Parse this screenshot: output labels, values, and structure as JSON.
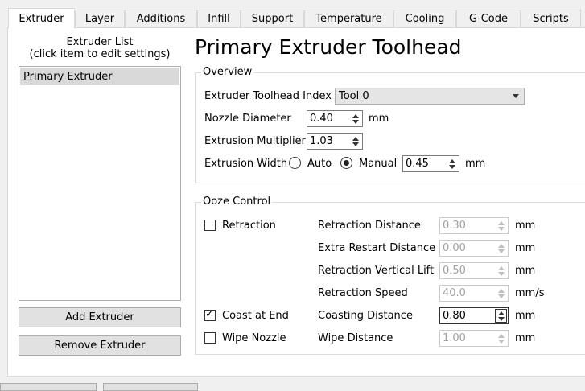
{
  "tabs": [
    {
      "label": "Extruder"
    },
    {
      "label": "Layer"
    },
    {
      "label": "Additions"
    },
    {
      "label": "Infill"
    },
    {
      "label": "Support"
    },
    {
      "label": "Temperature"
    },
    {
      "label": "Cooling"
    },
    {
      "label": "G-Code"
    },
    {
      "label": "Scripts"
    }
  ],
  "left": {
    "list_title_1": "Extruder List",
    "list_title_2": "(click item to edit settings)",
    "items": [
      "Primary Extruder"
    ],
    "add_button": "Add Extruder",
    "remove_button": "Remove Extruder"
  },
  "header": {
    "title": "Primary Extruder Toolhead"
  },
  "overview": {
    "group_label": "Overview",
    "toolhead_label": "Extruder Toolhead Index",
    "toolhead_value": "Tool 0",
    "nozzle_label": "Nozzle Diameter",
    "nozzle_value": "0.40",
    "nozzle_unit": "mm",
    "mult_label": "Extrusion Multiplier",
    "mult_value": "1.03",
    "width_label": "Extrusion Width",
    "auto_label": "Auto",
    "manual_label": "Manual",
    "width_value": "0.45",
    "width_unit": "mm"
  },
  "ooze": {
    "group_label": "Ooze Control",
    "retraction_label": "Retraction",
    "coast_label": "Coast at End",
    "wipe_label": "Wipe Nozzle",
    "rows": [
      {
        "label": "Retraction Distance",
        "value": "0.30",
        "unit": "mm"
      },
      {
        "label": "Extra Restart Distance",
        "value": "0.00",
        "unit": "mm"
      },
      {
        "label": "Retraction Vertical Lift",
        "value": "0.50",
        "unit": "mm"
      },
      {
        "label": "Retraction Speed",
        "value": "40.0",
        "unit": "mm/s"
      },
      {
        "label": "Coasting Distance",
        "value": "0.80",
        "unit": "mm"
      },
      {
        "label": "Wipe Distance",
        "value": "1.00",
        "unit": "mm"
      }
    ]
  }
}
